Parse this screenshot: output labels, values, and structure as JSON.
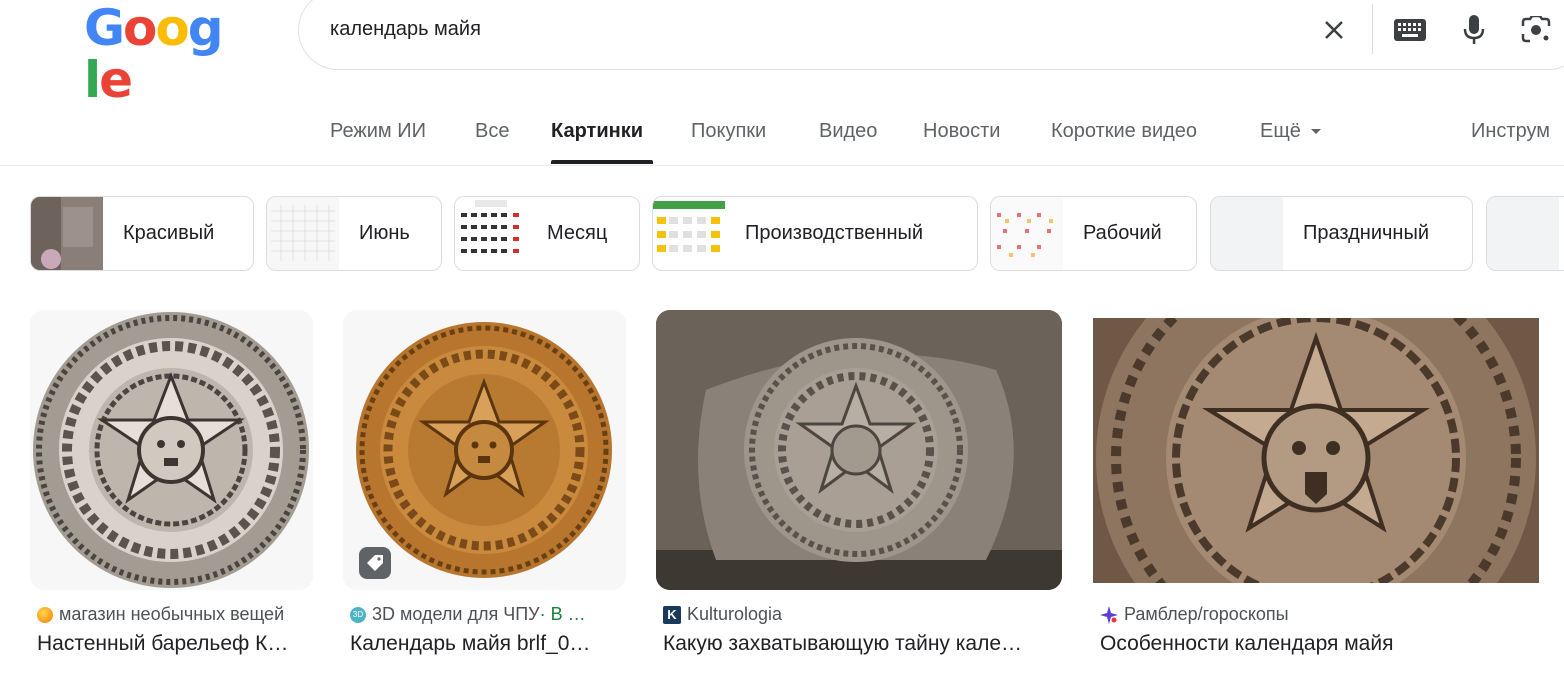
{
  "logo": {
    "letters": [
      "G",
      "o",
      "o",
      "g",
      "l",
      "e"
    ],
    "colors": [
      "#4285F4",
      "#EA4335",
      "#FBBC05",
      "#4285F4",
      "#34A853",
      "#EA4335"
    ]
  },
  "search": {
    "query": "календарь майя",
    "icons": [
      "close-icon",
      "keyboard-icon",
      "microphone-icon",
      "lens-icon"
    ]
  },
  "tabs": [
    {
      "label": "Режим ИИ",
      "active": false
    },
    {
      "label": "Все",
      "active": false
    },
    {
      "label": "Картинки",
      "active": true
    },
    {
      "label": "Покупки",
      "active": false
    },
    {
      "label": "Видео",
      "active": false
    },
    {
      "label": "Новости",
      "active": false
    },
    {
      "label": "Короткие видео",
      "active": false
    },
    {
      "label": "Ещё",
      "active": false
    }
  ],
  "tools_label": "Инструм",
  "chips": [
    {
      "label": "Красивый"
    },
    {
      "label": "Июнь"
    },
    {
      "label": "Месяц"
    },
    {
      "label": "Производственный"
    },
    {
      "label": "Рабочий"
    },
    {
      "label": "Праздничный"
    }
  ],
  "results": [
    {
      "source": "магазин необычных вещей",
      "title": "Настенный барельеф К…",
      "favicon_color": "#f9a825"
    },
    {
      "source": "3D модели для ЧПУ",
      "source_extra": " · В …",
      "title": "Календарь майя brlf_0…",
      "favicon_label": "3D",
      "favicon_color": "#4fb3c8"
    },
    {
      "source": "Kulturologia",
      "title": "Какую захватывающую тайну кале…",
      "favicon_label": "K",
      "favicon_color": "#1a3a5c"
    },
    {
      "source": "Рамблер/гороскопы",
      "title": "Особенности календаря майя",
      "favicon_color": "#5b3fd6"
    }
  ],
  "colors": {
    "accent_text": "#202124",
    "muted_text": "#5f6368",
    "source_extra_green": "#188038"
  }
}
